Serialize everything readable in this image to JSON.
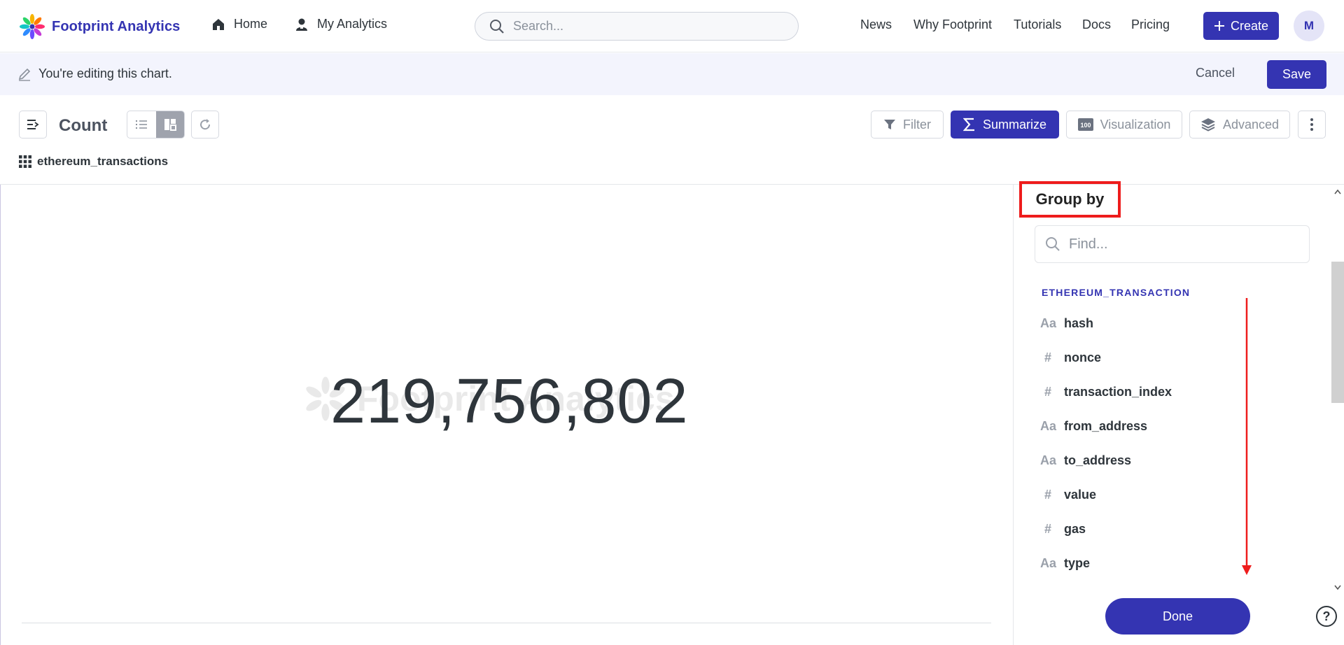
{
  "nav": {
    "brand": "Footprint Analytics",
    "home": "Home",
    "my_analytics": "My Analytics",
    "search_placeholder": "Search...",
    "links": [
      "News",
      "Why Footprint",
      "Tutorials",
      "Docs",
      "Pricing"
    ],
    "create": "Create",
    "avatar_initial": "M"
  },
  "edit_bar": {
    "message": "You're editing this chart.",
    "cancel": "Cancel",
    "save": "Save"
  },
  "query": {
    "title": "Count",
    "filter": "Filter",
    "summarize": "Summarize",
    "visualization": "Visualization",
    "advanced": "Advanced",
    "source_table": "ethereum_transactions"
  },
  "viz": {
    "value": "219,756,802",
    "watermark": "Footprint Analytics"
  },
  "sidebar": {
    "heading": "Group by",
    "find_placeholder": "Find...",
    "table_name": "ETHEREUM_TRANSACTION",
    "fields": [
      {
        "type": "Aa",
        "name": "hash"
      },
      {
        "type": "#",
        "name": "nonce"
      },
      {
        "type": "#",
        "name": "transaction_index"
      },
      {
        "type": "Aa",
        "name": "from_address"
      },
      {
        "type": "Aa",
        "name": "to_address"
      },
      {
        "type": "#",
        "name": "value"
      },
      {
        "type": "#",
        "name": "gas"
      },
      {
        "type": "Aa",
        "name": "type"
      }
    ],
    "done": "Done"
  },
  "help": "?",
  "colors": {
    "brand": "#3434b2",
    "highlight": "#ee1c1c"
  }
}
